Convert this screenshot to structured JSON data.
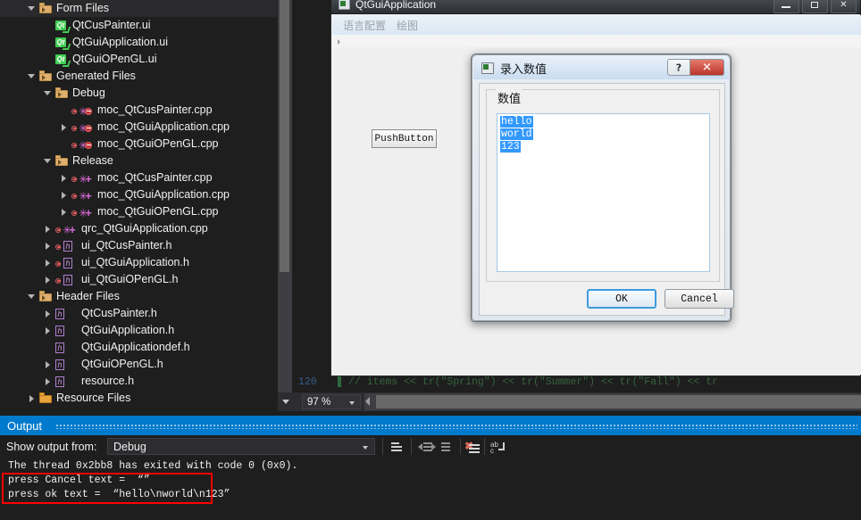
{
  "solution_explorer": {
    "tree": [
      {
        "label": "Form Files",
        "icon": "folder-icon",
        "indent": 0,
        "expander": "expanded",
        "type": "folder"
      },
      {
        "label": "QtCusPainter.ui",
        "icon": "qt-ui-icon",
        "indent": 1,
        "expander": "none",
        "type": "qt"
      },
      {
        "label": "QtGuiApplication.ui",
        "icon": "qt-ui-icon",
        "indent": 1,
        "expander": "none",
        "type": "qt"
      },
      {
        "label": "QtGuiOPenGL.ui",
        "icon": "qt-ui-icon",
        "indent": 1,
        "expander": "none",
        "type": "qt"
      },
      {
        "label": "Generated Files",
        "icon": "folder-icon",
        "indent": 0,
        "expander": "expanded",
        "type": "folder"
      },
      {
        "label": "Debug",
        "icon": "folder-icon",
        "indent": 1,
        "expander": "expanded",
        "type": "folder"
      },
      {
        "label": "moc_QtCusPainter.cpp",
        "icon": "cpp-file-icon",
        "indent": 2,
        "expander": "none",
        "type": "cpp"
      },
      {
        "label": "moc_QtGuiApplication.cpp",
        "icon": "cpp-file-icon",
        "indent": 2,
        "expander": "collapsed",
        "type": "cpp"
      },
      {
        "label": "moc_QtGuiOPenGL.cpp",
        "icon": "cpp-file-icon",
        "indent": 2,
        "expander": "none",
        "type": "cpp"
      },
      {
        "label": "Release",
        "icon": "folder-icon",
        "indent": 1,
        "expander": "expanded",
        "type": "folder"
      },
      {
        "label": "moc_QtCusPainter.cpp",
        "icon": "cpp-file-icon",
        "indent": 2,
        "expander": "collapsed",
        "type": "cpprel"
      },
      {
        "label": "moc_QtGuiApplication.cpp",
        "icon": "cpp-file-icon",
        "indent": 2,
        "expander": "collapsed",
        "type": "cpprel"
      },
      {
        "label": "moc_QtGuiOPenGL.cpp",
        "icon": "cpp-file-icon",
        "indent": 2,
        "expander": "collapsed",
        "type": "cpprel"
      },
      {
        "label": "qrc_QtGuiApplication.cpp",
        "icon": "cpp-file-icon",
        "indent": 1,
        "expander": "collapsed",
        "type": "cpprel"
      },
      {
        "label": "ui_QtCusPainter.h",
        "icon": "header-file-icon",
        "indent": 1,
        "expander": "collapsed",
        "type": "hdash"
      },
      {
        "label": "ui_QtGuiApplication.h",
        "icon": "header-file-icon",
        "indent": 1,
        "expander": "collapsed",
        "type": "hdash"
      },
      {
        "label": "ui_QtGuiOPenGL.h",
        "icon": "header-file-icon",
        "indent": 1,
        "expander": "collapsed",
        "type": "hdash"
      },
      {
        "label": "Header Files",
        "icon": "folder-icon",
        "indent": 0,
        "expander": "expanded",
        "type": "folder"
      },
      {
        "label": "QtCusPainter.h",
        "icon": "header-file-icon",
        "indent": 1,
        "expander": "collapsed",
        "type": "h"
      },
      {
        "label": "QtGuiApplication.h",
        "icon": "header-file-icon",
        "indent": 1,
        "expander": "collapsed",
        "type": "h"
      },
      {
        "label": "QtGuiApplicationdef.h",
        "icon": "header-file-icon",
        "indent": 1,
        "expander": "none",
        "type": "h"
      },
      {
        "label": "QtGuiOPenGL.h",
        "icon": "header-file-icon",
        "indent": 1,
        "expander": "collapsed",
        "type": "h"
      },
      {
        "label": "resource.h",
        "icon": "header-file-icon",
        "indent": 1,
        "expander": "collapsed",
        "type": "h"
      },
      {
        "label": "Resource Files",
        "icon": "folder-icon",
        "indent": 0,
        "expander": "collapsed",
        "type": "folderres"
      }
    ]
  },
  "editor": {
    "zoom_level": "97 %",
    "code_line_number": "120",
    "code_text": "//       items << tr(\"Spring\") << tr(\"Summer\") << tr(\"Fall\") << tr"
  },
  "app_window": {
    "title": "QtGuiApplication",
    "menu": [
      "语言配置",
      "绘图"
    ],
    "push_button_label": "PushButton",
    "window_buttons": {
      "minimize": "minimize-icon",
      "maximize": "maximize-icon",
      "close": "✕"
    }
  },
  "dialog": {
    "title": "录入数值",
    "help_glyph": "?",
    "close_glyph": "✕",
    "group_title": "数值",
    "text_lines": [
      "hello",
      "world",
      "123"
    ],
    "ok_label": "OK",
    "cancel_label": "Cancel"
  },
  "output": {
    "panel_title": "Output",
    "show_output_from_label": "Show output from:",
    "source": "Debug",
    "toolbar": [
      {
        "name": "find-message-in-code-icon"
      },
      {
        "name": "go-to-previous-message-icon"
      },
      {
        "name": "go-to-next-message-icon"
      },
      {
        "name": "clear-all-icon"
      },
      {
        "name": "toggle-word-wrap-icon"
      }
    ],
    "lines": [
      "The thread 0x2bb8 has exited with code 0 (0x0).",
      "press Cancel text =  “”",
      "press ok text =  “hello\\nworld\\n123”"
    ]
  },
  "colors": {
    "accent_blue": "#007acc",
    "selection_blue": "#3399ff",
    "shell_bg": "#1e1e1e",
    "highlight_red": "#ff0000"
  }
}
